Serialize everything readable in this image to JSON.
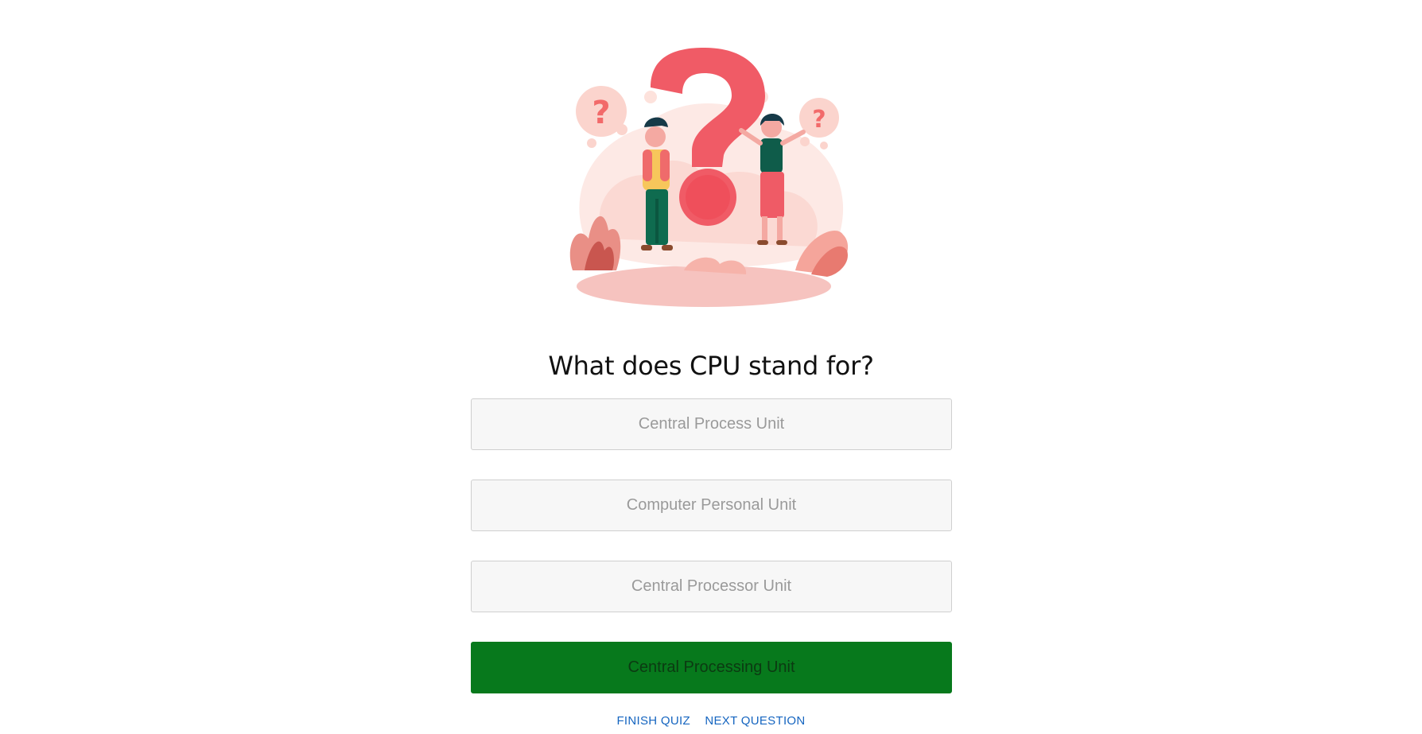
{
  "question": {
    "text": "What does CPU stand for?"
  },
  "options": [
    {
      "label": "Central Process Unit",
      "state": "default"
    },
    {
      "label": "Computer Personal Unit",
      "state": "default"
    },
    {
      "label": "Central Processor Unit",
      "state": "default"
    },
    {
      "label": "Central Processing Unit",
      "state": "correct"
    }
  ],
  "actions": {
    "finish_label": "FINISH QUIZ",
    "next_label": "NEXT QUESTION"
  },
  "colors": {
    "correct": "#07791c",
    "link": "#1565c0",
    "accent_illustration": "#f0646e"
  },
  "illustration": {
    "icon": "question-mark-people-illustration"
  }
}
